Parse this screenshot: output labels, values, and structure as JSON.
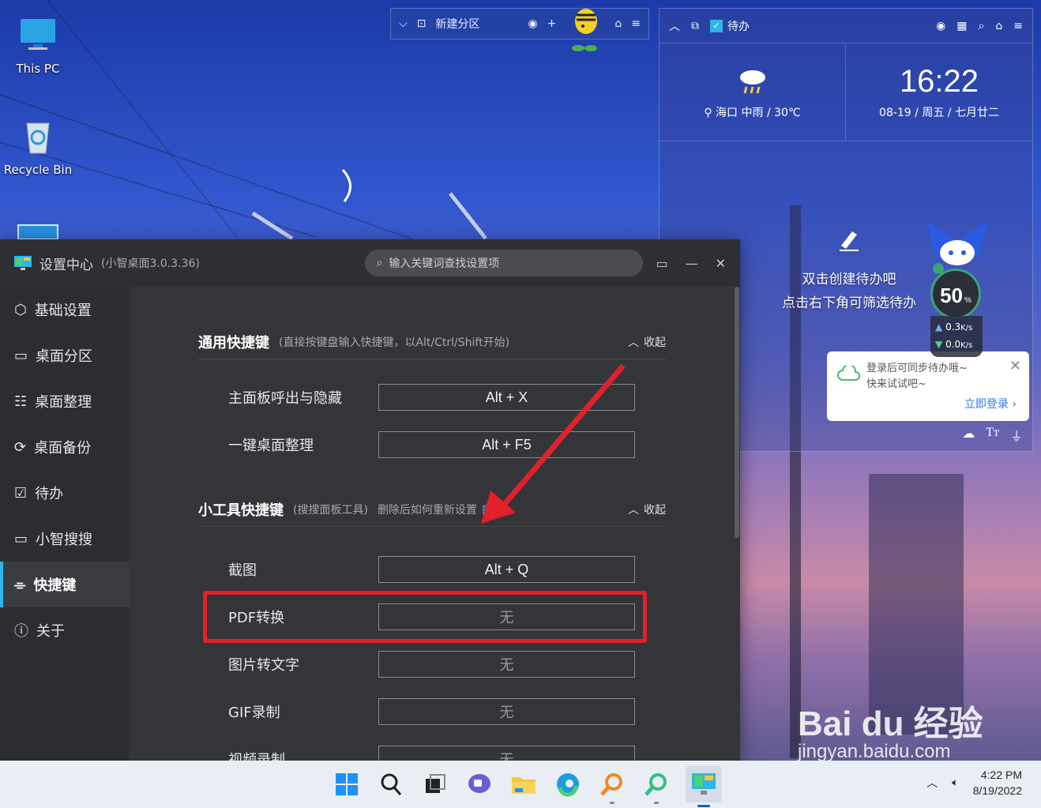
{
  "desktop": {
    "icons": [
      {
        "label": "This PC"
      },
      {
        "label": "Recycle Bin"
      }
    ]
  },
  "partition_bar": {
    "title": "新建分区"
  },
  "widget": {
    "todo_label": "待办",
    "weather": {
      "location": "海口",
      "condition": "中雨",
      "temperature": "30℃",
      "separator": "/"
    },
    "clock": {
      "time": "16:22",
      "date": "08-19 / 周五 / 七月廿二"
    },
    "empty_line1": "双击创建待办吧",
    "empty_line2": "点击右下角可筛选待办",
    "login_card": {
      "line1": "登录后可同步待办哦~",
      "line2": "快来试试吧~",
      "link": "立即登录 ›"
    }
  },
  "speed_ball": {
    "percent": "50",
    "percent_unit": "%",
    "upload": "0.3",
    "download": "0.0",
    "rate_unit": "K/s"
  },
  "settings": {
    "title": "设置中心",
    "version": "(小智桌面3.0.3.36)",
    "search_placeholder": "输入关键词查找设置项",
    "nav": [
      {
        "label": "基础设置",
        "icon": "hexagon-gear-icon"
      },
      {
        "label": "桌面分区",
        "icon": "monitor-icon"
      },
      {
        "label": "桌面整理",
        "icon": "list-icon"
      },
      {
        "label": "桌面备份",
        "icon": "sync-icon"
      },
      {
        "label": "待办",
        "icon": "calendar-check-icon"
      },
      {
        "label": "小智搜搜",
        "icon": "window-icon"
      },
      {
        "label": "快捷键",
        "icon": "mouse-icon"
      },
      {
        "label": "关于",
        "icon": "info-icon"
      }
    ],
    "active_nav": "快捷键",
    "sections": [
      {
        "title": "通用快捷键",
        "hint": "(直接按键盘输入快捷键，以Alt/Ctrl/Shift开始)",
        "collapse": "收起",
        "rows": [
          {
            "label": "主面板呼出与隐藏",
            "value": "Alt + X"
          },
          {
            "label": "一键桌面整理",
            "value": "Alt + F5"
          }
        ]
      },
      {
        "title": "小工具快捷键",
        "hint": "(搜搜面板工具)",
        "hint2": "删除后如何重新设置",
        "collapse": "收起",
        "rows": [
          {
            "label": "截图",
            "value": "Alt + Q"
          },
          {
            "label": "PDF转换",
            "value": "无"
          },
          {
            "label": "图片转文字",
            "value": "无"
          },
          {
            "label": "GIF录制",
            "value": "无"
          },
          {
            "label": "视频录制",
            "value": "无"
          }
        ]
      }
    ]
  },
  "taskbar": {
    "time": "4:22 PM",
    "date": "8/19/2022"
  },
  "watermark": {
    "brand": "Bai du 经验",
    "url": "jingyan.baidu.com"
  },
  "colors": {
    "accent": "#2fb6e8",
    "highlight": "#e0202a",
    "window_bg": "#333538",
    "sidebar_bg": "#2b2d30"
  }
}
